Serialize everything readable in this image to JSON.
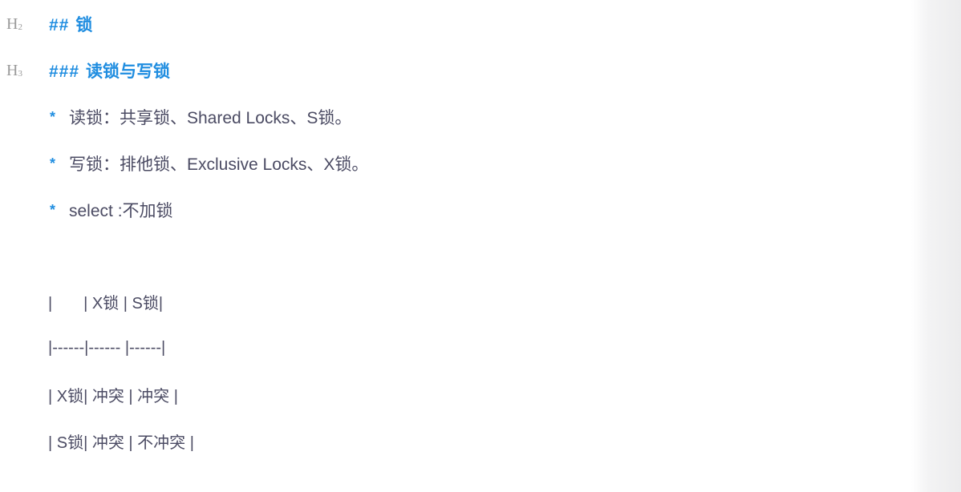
{
  "h2": {
    "gutter_letter": "H",
    "gutter_level": "2",
    "marks": "##",
    "text": "锁"
  },
  "h3": {
    "gutter_letter": "H",
    "gutter_level": "3",
    "marks": "###",
    "text": "读锁与写锁"
  },
  "list": {
    "bullet": "*",
    "items": [
      "读锁：共享锁、Shared Locks、S锁。",
      "写锁：排他锁、Exclusive Locks、X锁。",
      "select :不加锁"
    ]
  },
  "table_lines": [
    "|       | X锁 | S锁|",
    "|------|------ |------|",
    "| X锁| 冲突 | 冲突 |",
    "| S锁| 冲突 | 不冲突 |"
  ]
}
